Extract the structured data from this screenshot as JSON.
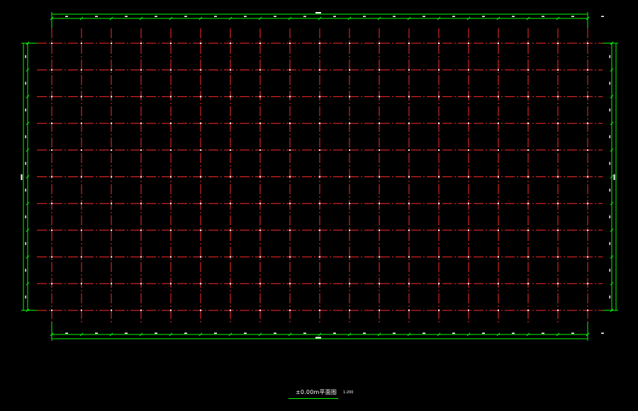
{
  "drawing": {
    "title": "±0.00m平面图",
    "scale": "1:200"
  },
  "colors": {
    "background": "#000000",
    "axis_line": "#ff2a2a",
    "dimension_line": "#00ff00",
    "column_marker": "#ffffff",
    "text": "#ffffff"
  },
  "grid": {
    "vertical_axis_count": 19,
    "horizontal_axis_count": 11,
    "line_style": "dash-dot"
  }
}
